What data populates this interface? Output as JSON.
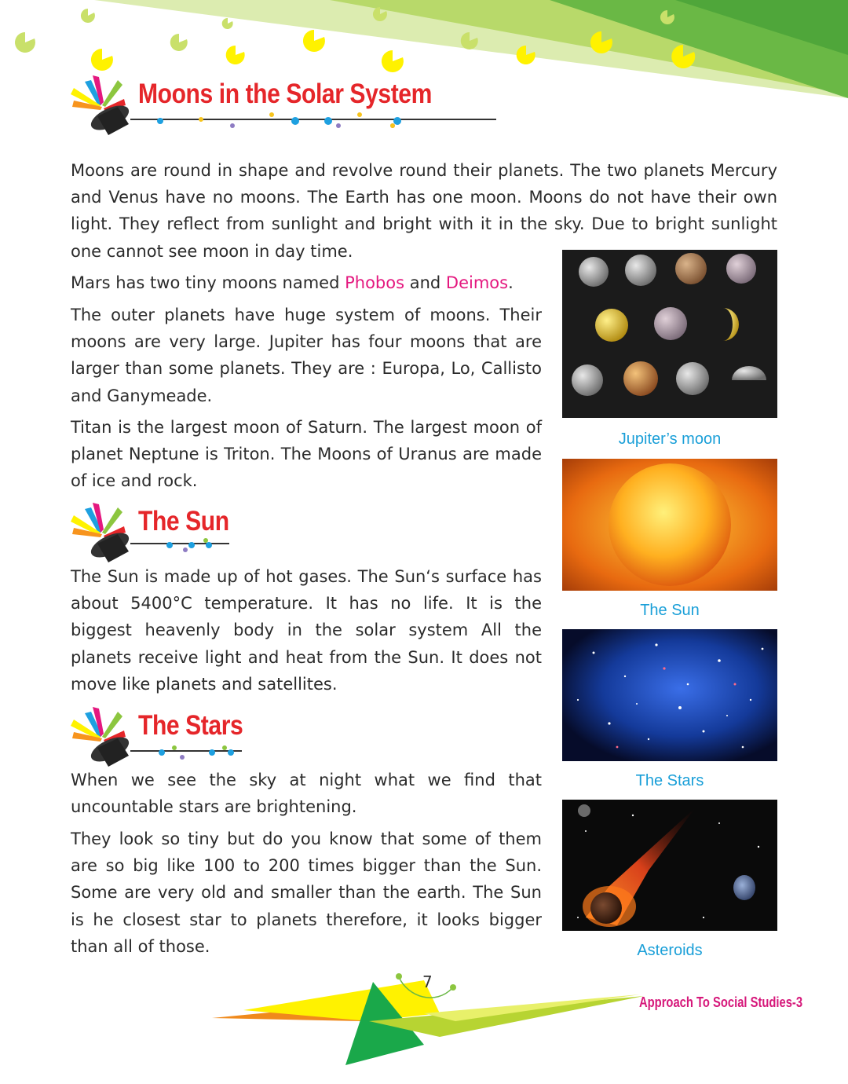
{
  "sections": [
    {
      "heading": "Moons in the Solar System"
    },
    {
      "heading": "The Sun"
    },
    {
      "heading": "The Stars"
    }
  ],
  "moons": {
    "p1": "Moons are round in shape and revolve round their planets. The two planets Mercury and Venus have no moons. The Earth has one moon. Moons do not have their own light. They reflect from sunlight and bright with it in the sky. Due to bright sunlight one cannot see moon in day time.",
    "p2_before": "Mars has two tiny moons named ",
    "p2_phobos": "Phobos",
    "p2_and": " and ",
    "p2_deimos": "Deimos",
    "p2_end": ".",
    "p3": "The outer planets have huge system of moons. Their moons are very large. Jupiter has four moons that are larger than some planets. They are : Europa, Lo, Callisto and Ganymeade.",
    "p4": "Titan is the largest moon of Saturn. The largest moon of planet Neptune is Triton. The Moons of Uranus are made of ice and rock."
  },
  "sun": {
    "p1": "The Sun is made up of hot gases. The Sun‘s surface has about 5400°C temperature. It has no life. It is the biggest heavenly body in the solar system All the planets receive light and heat from the Sun. It does not move like planets and satellites."
  },
  "stars": {
    "p1": "When we see the sky at night what we find that uncountable stars are brightening.",
    "p2": "They look so tiny but do you know that some of them are so big like 100 to 200 times bigger than the Sun. Some are very old and smaller than the earth. The Sun is he closest star to planets therefore, it looks bigger than all of those."
  },
  "figures": [
    {
      "caption": "Jupiter’s moon"
    },
    {
      "caption": "The Sun"
    },
    {
      "caption": "The Stars"
    },
    {
      "caption": "Asteroids"
    }
  ],
  "footer": {
    "page_number": "7",
    "book_title": "Approach To Social Studies-3"
  },
  "colors": {
    "heading": "#e5262a",
    "highlight": "#e4187f",
    "caption": "#1a9fd8",
    "green": "#6ab845",
    "yellow": "#fff200"
  }
}
